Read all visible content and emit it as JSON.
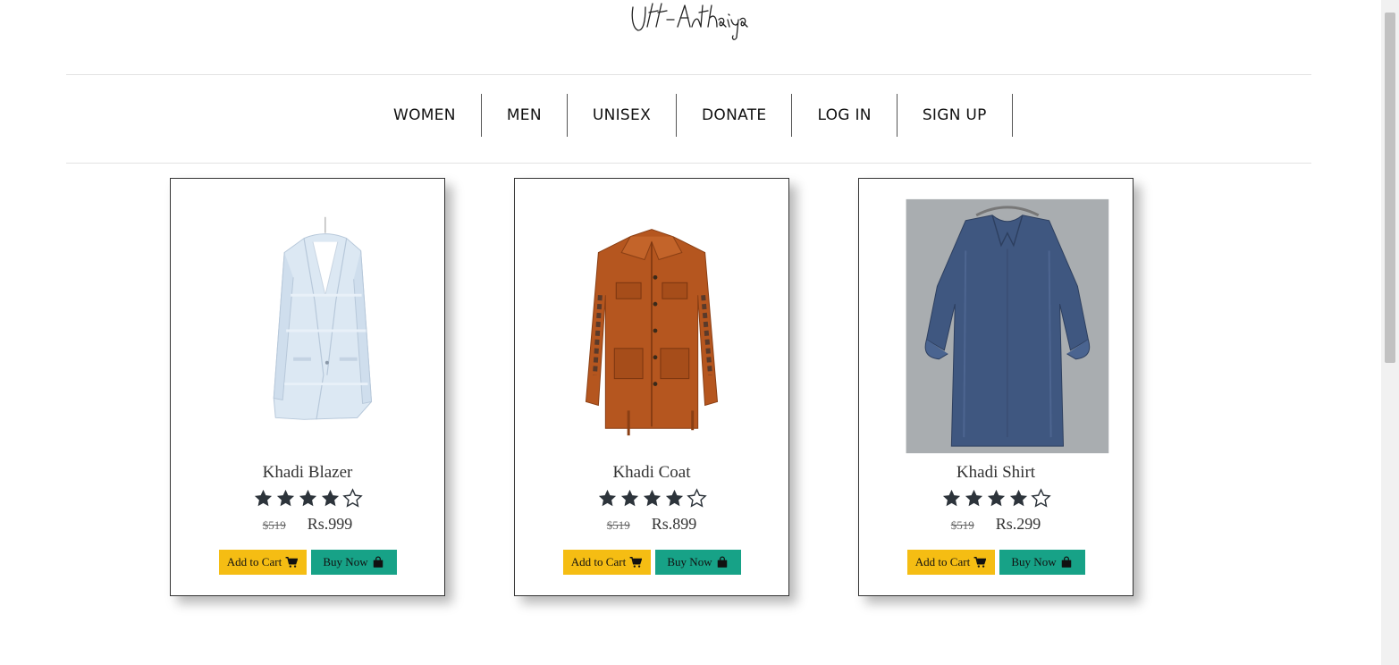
{
  "brand": {
    "logo_text": "Utt-Antariya"
  },
  "nav": {
    "items": [
      "WOMEN",
      "MEN",
      "UNISEX",
      "DONATE",
      "LOG IN",
      "SIGN UP"
    ]
  },
  "products": [
    {
      "name": "Khadi Blazer",
      "rating": 4,
      "max_rating": 5,
      "old_price": "$519",
      "price": "Rs.999",
      "add_to_cart": "Add to Cart",
      "buy_now": "Buy Now",
      "image_icon": "blazer-image"
    },
    {
      "name": "Khadi Coat",
      "rating": 4,
      "max_rating": 5,
      "old_price": "$519",
      "price": "Rs.899",
      "add_to_cart": "Add to Cart",
      "buy_now": "Buy Now",
      "image_icon": "coat-image"
    },
    {
      "name": "Khadi Shirt",
      "rating": 4,
      "max_rating": 5,
      "old_price": "$519",
      "price": "Rs.299",
      "add_to_cart": "Add to Cart",
      "buy_now": "Buy Now",
      "image_icon": "shirt-image"
    }
  ],
  "colors": {
    "cart_button": "#f5bd13",
    "buy_button": "#17a287",
    "star": "#2d343b"
  }
}
